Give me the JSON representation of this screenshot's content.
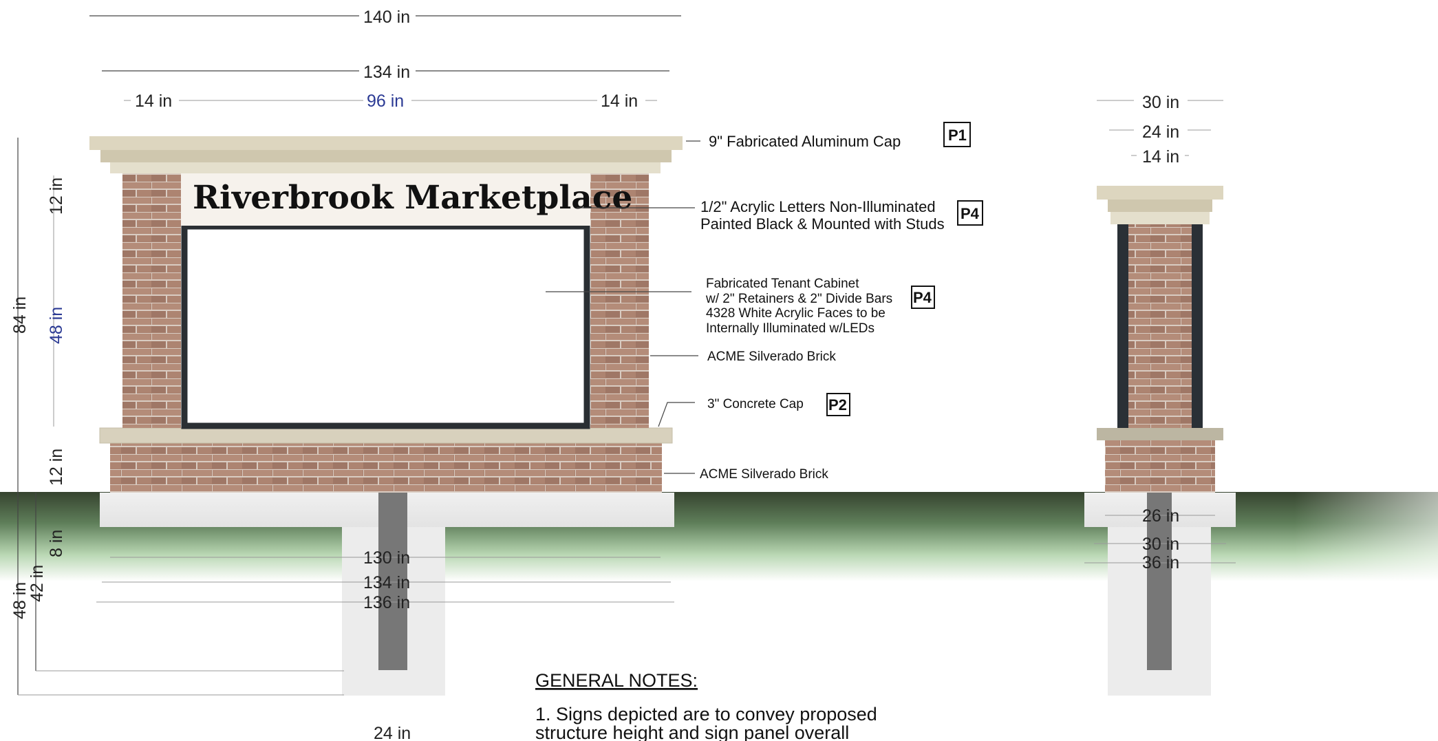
{
  "sign": {
    "title": "Riverbrook Marketplace"
  },
  "dimensions": {
    "top": [
      "140 in",
      "134 in",
      "14 in",
      "96 in",
      "14 in"
    ],
    "left": [
      "12 in",
      "84 in",
      "48 in",
      "12 in",
      "8 in",
      "48 in",
      "42 in"
    ],
    "footing": [
      "130 in",
      "134 in",
      "136 in",
      "24 in"
    ],
    "side_top": [
      "30 in",
      "24 in",
      "14 in"
    ],
    "side_footing": [
      "26 in",
      "30 in",
      "36 in"
    ]
  },
  "callouts": {
    "cap": {
      "text": "9\" Fabricated Aluminum Cap",
      "tag": "P1"
    },
    "letters": {
      "line1": "1/2\" Acrylic Letters Non-Illuminated",
      "line2": "Painted Black & Mounted with Studs",
      "tag": "P4"
    },
    "cabinet": {
      "line1": "Fabricated Tenant Cabinet",
      "line2": "w/ 2\" Retainers & 2\" Divide Bars",
      "line3": "4328 White Acrylic Faces to be",
      "line4": "Internally Illuminated w/LEDs",
      "tag": "P4"
    },
    "brick1": {
      "text": "ACME Silverado Brick"
    },
    "concrete": {
      "text": "3\" Concrete Cap",
      "tag": "P2"
    },
    "brick2": {
      "text": "ACME Silverado Brick"
    }
  },
  "notes": {
    "heading": "GENERAL NOTES:",
    "line1": "1. Signs depicted are to convey proposed",
    "line2": "structure height and sign panel overall"
  },
  "colors": {
    "brick": "#a87f6e",
    "cap": "#ddd6bf",
    "ground": "#3d4a3a",
    "cabinet_border": "#2a2f33"
  }
}
